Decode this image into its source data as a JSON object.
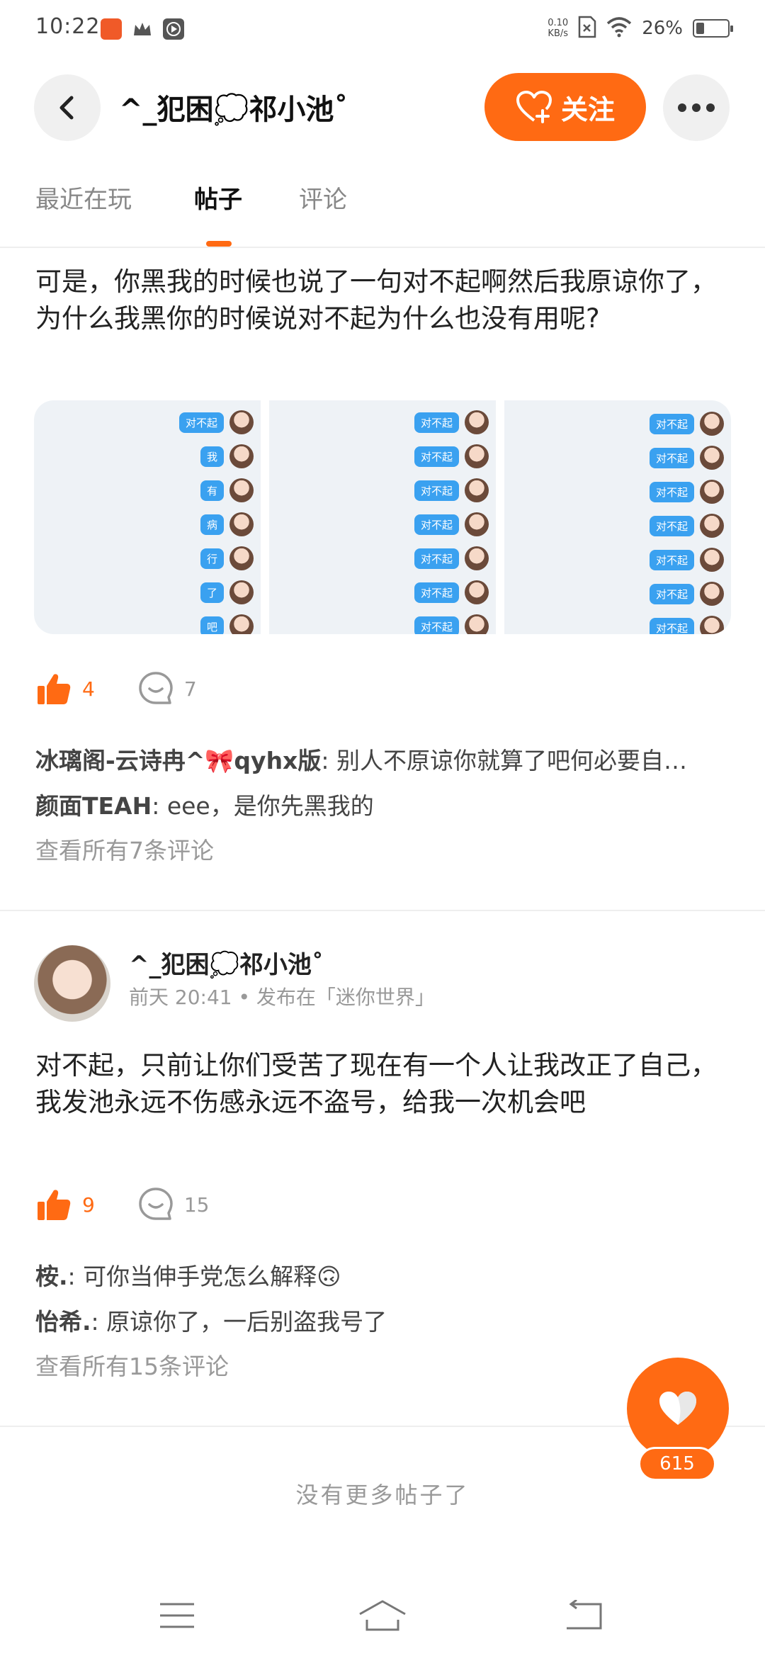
{
  "status_bar": {
    "time": "10:22",
    "net_speed_value": "0.10",
    "net_speed_unit": "KB/s",
    "battery_percent": "26%",
    "battery_level": 0.26,
    "app_icons": [
      "video-app-icon",
      "crown-icon",
      "play-box-icon"
    ]
  },
  "header": {
    "title": "^_犯困💭祁小池˚",
    "follow_label": "关注"
  },
  "tabs": [
    {
      "label": "最近在玩"
    },
    {
      "label": "帖子"
    },
    {
      "label": "评论"
    }
  ],
  "posts": [
    {
      "text": "可是，你黑我的时候也说了一句对不起啊然后我原谅你了，为什么我黑你的时候说对不起为什么也没有用呢?",
      "images": [
        {
          "bubbles": [
            "对不起",
            "我",
            "有",
            "病",
            "行",
            "了",
            "吧"
          ]
        },
        {
          "bubbles": [
            "对不起",
            "对不起",
            "对不起",
            "对不起",
            "对不起",
            "对不起",
            "对不起"
          ]
        },
        {
          "bubbles": [
            "对不起",
            "对不起",
            "对不起",
            "对不起",
            "对不起",
            "对不起",
            "对不起"
          ]
        }
      ],
      "likes": "4",
      "comment_count": "7",
      "comments": [
        {
          "author": "冰璃阁-云诗冉^🎀qyhx版",
          "text": "别人不原谅你就算了吧何必要自…"
        },
        {
          "author": "颜面TEAH",
          "text": "eee，是你先黑我的"
        }
      ],
      "view_all": "查看所有7条评论"
    },
    {
      "author": "^_犯困💭祁小池˚",
      "meta": "前天 20:41 • 发布在「迷你世界」",
      "text": "对不起，只前让你们受苦了现在有一个人让我改正了自己，我发池永远不伤感永远不盗号，给我一次机会吧",
      "likes": "9",
      "comment_count": "15",
      "comments": [
        {
          "author": "桉.",
          "text": "可你当伸手党怎么解释🙃"
        },
        {
          "author": "怡希.",
          "text": "原谅你了，一后别盗我号了"
        }
      ],
      "view_all": "查看所有15条评论"
    }
  ],
  "end_text": "没有更多帖子了",
  "fab": {
    "count": "615"
  },
  "colors": {
    "accent": "#ff6a13",
    "bubble": "#3aa1f0"
  }
}
